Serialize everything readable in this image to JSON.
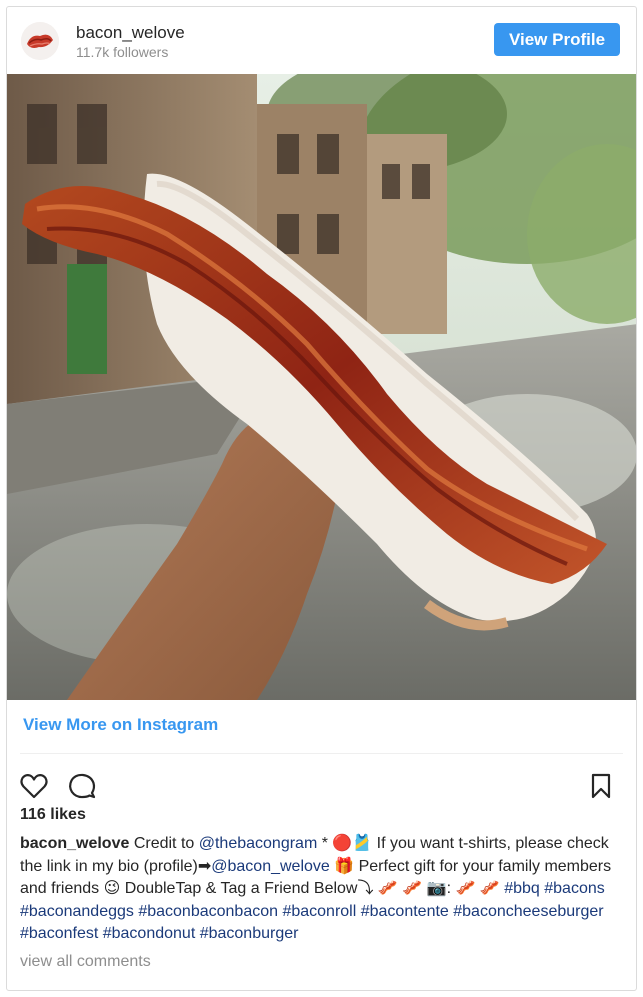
{
  "header": {
    "username": "bacon_welove",
    "followers": "11.7k followers",
    "view_profile_label": "View Profile"
  },
  "photo": {
    "alt": "Bacon strip on a glazed long john donut held up on a city street"
  },
  "view_more_label": "View More on Instagram",
  "likes": "116 likes",
  "caption": {
    "username": "bacon_welove",
    "text_1": " Credit to ",
    "mention_1": "@thebacongram",
    "text_2": " * 🔴🎽 If you want t-shirts, please check the link in my bio (profile)➡",
    "mention_2": "@bacon_welove",
    "text_3": " 🎁 Perfect gift for your family members and friends 😉 DoubleTap & Tag a Friend Below⤵ 🥓 🥓 📷: 🥓 🥓 ",
    "hashtags": "#bbq #bacons #baconandeggs #baconbaconbacon #baconroll #bacontente #baconcheeseburger #baconfest #bacondonut #baconburger"
  },
  "view_comments_label": "view all comments",
  "colors": {
    "accent": "#3897f0",
    "link": "#1b3a7a",
    "muted": "#8e8e8e",
    "border": "#dbdbdb"
  },
  "icons": [
    "heart-icon",
    "comment-icon",
    "bookmark-icon"
  ]
}
